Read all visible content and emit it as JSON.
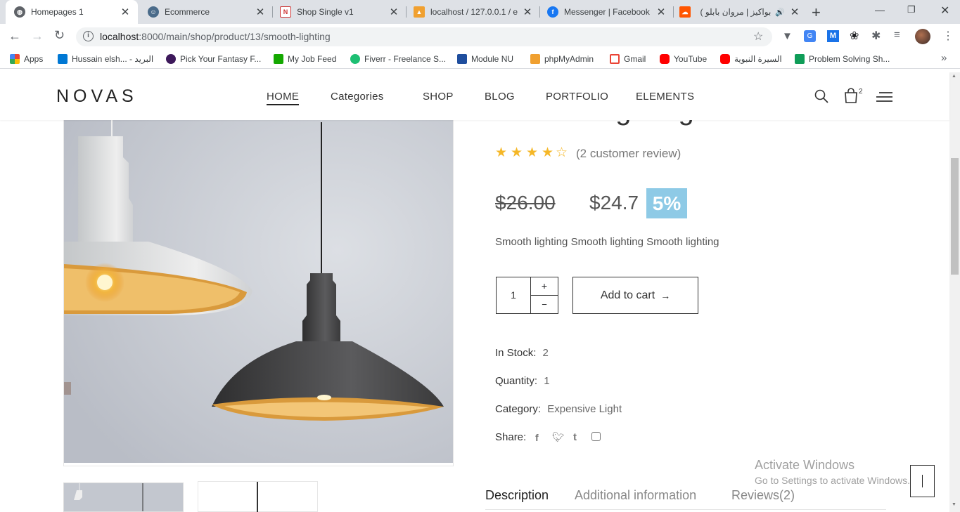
{
  "browser": {
    "tabs": [
      {
        "title": "Homepages 1",
        "active": true
      },
      {
        "title": "Ecommerce",
        "active": false
      },
      {
        "title": "Shop Single v1",
        "active": false
      },
      {
        "title": "localhost / 127.0.0.1 / e",
        "active": false
      },
      {
        "title": "Messenger | Facebook",
        "active": false
      },
      {
        "title": "بواكيز | مروان بابلو )",
        "active": false
      }
    ],
    "new_tab": "+",
    "url_host": "localhost",
    "url_path": ":8000/main/shop/product/13/smooth-lighting",
    "bookmarks": [
      {
        "label": "Apps"
      },
      {
        "label": "Hussain elsh... - البريد"
      },
      {
        "label": "Pick Your Fantasy F..."
      },
      {
        "label": "My Job Feed"
      },
      {
        "label": "Fiverr - Freelance S..."
      },
      {
        "label": "Module NU"
      },
      {
        "label": "phpMyAdmin"
      },
      {
        "label": "Gmail"
      },
      {
        "label": "YouTube"
      },
      {
        "label": "السيرة النبوية"
      },
      {
        "label": "Problem Solving Sh..."
      }
    ],
    "more_bookmarks": "»"
  },
  "site": {
    "logo": "NOVAS",
    "nav": [
      "HOME",
      "Categories",
      "SHOP",
      "BLOG",
      "PORTFOLIO",
      "ELEMENTS"
    ],
    "cart_count": "2"
  },
  "product": {
    "title": "Smooth lighting",
    "rating": 4,
    "review_text": "(2 customer review)",
    "old_price": "$26.00",
    "new_price": "$24.7",
    "discount": "5%",
    "short_description": "Smooth lighting Smooth lighting Smooth lighting",
    "qty_value": "1",
    "qty_plus": "+",
    "qty_minus": "−",
    "add_to_cart": "Add to cart",
    "in_stock_label": "In Stock:",
    "in_stock_value": "2",
    "quantity_label": "Quantity:",
    "quantity_value": "1",
    "category_label": "Category:",
    "category_value": "Expensive Light",
    "share_label": "Share:",
    "tabs": [
      "Description",
      "Additional information",
      "Reviews(2)"
    ]
  },
  "overlay": {
    "activate_title": "Activate Windows",
    "activate_sub": "Go to Settings to activate Windows."
  },
  "colors": {
    "discount_bg": "#8ecae6",
    "star": "#f5b727",
    "tab_strip": "#dee1e6"
  }
}
